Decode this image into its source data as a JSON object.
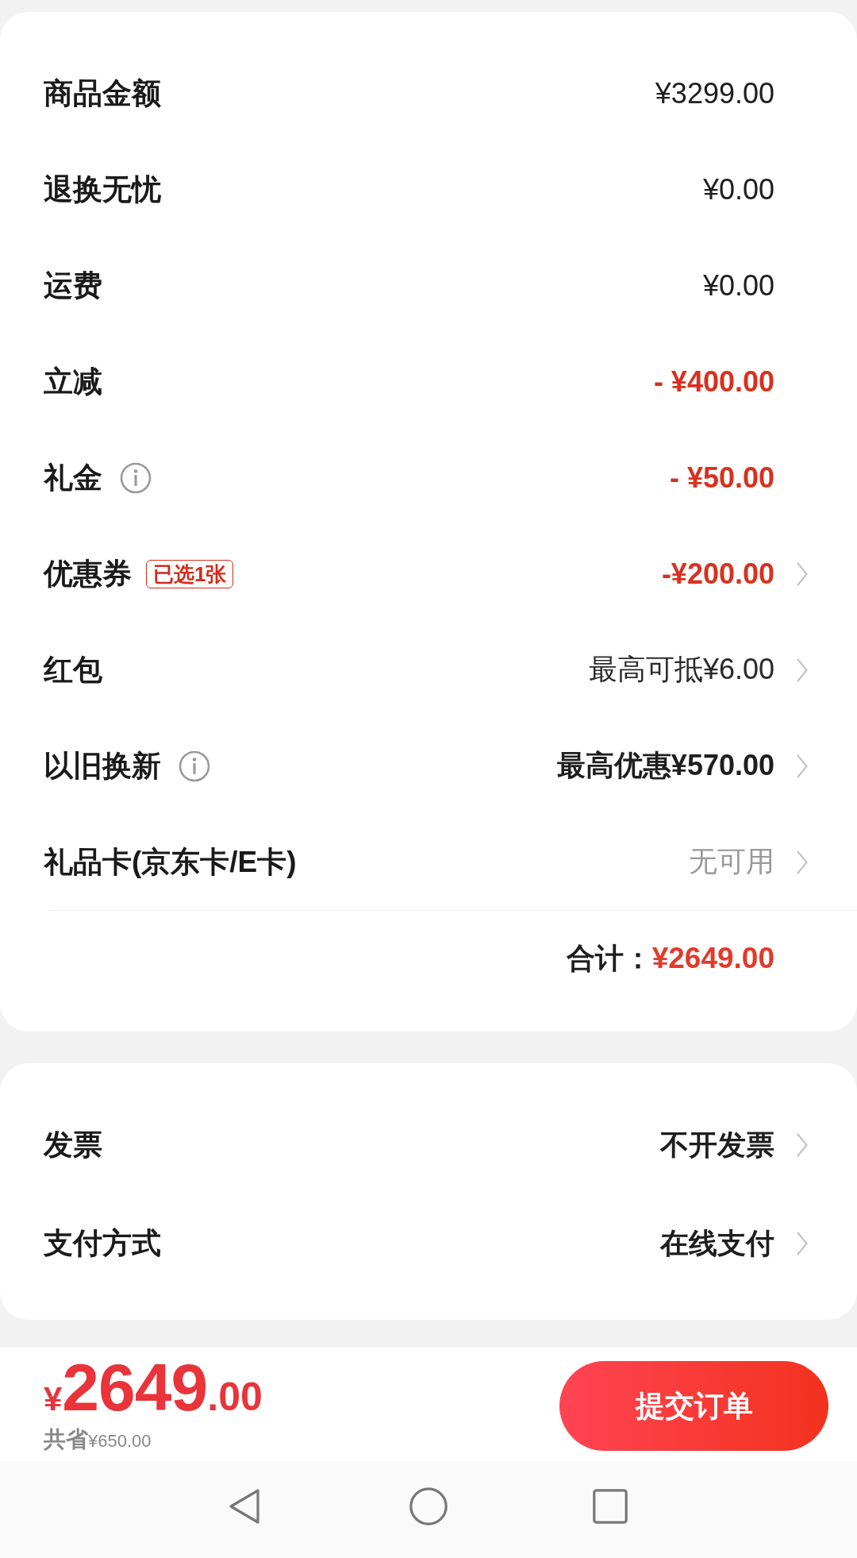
{
  "price_summary": {
    "rows": [
      {
        "label": "商品金额",
        "info": false,
        "value": "¥3299.00",
        "kind": "amount",
        "chevron": false
      },
      {
        "label": "退换无忧",
        "info": false,
        "value": "¥0.00",
        "kind": "amount",
        "chevron": false
      },
      {
        "label": "运费",
        "info": false,
        "value": "¥0.00",
        "kind": "amount",
        "chevron": false
      },
      {
        "label": "立减",
        "info": false,
        "value": "- ¥400.00",
        "kind": "discount",
        "chevron": false
      },
      {
        "label": "礼金",
        "info": true,
        "value": "- ¥50.00",
        "kind": "discount",
        "chevron": false
      },
      {
        "label": "优惠券",
        "info": false,
        "badge": "已选1张",
        "value": "-¥200.00",
        "kind": "discount",
        "chevron": true
      },
      {
        "label": "红包",
        "info": false,
        "value": "最高可抵¥6.00",
        "kind": "hint",
        "chevron": true
      },
      {
        "label": "以旧换新",
        "info": true,
        "value": "最高优惠¥570.00",
        "kind": "offer",
        "chevron": true
      },
      {
        "label": "礼品卡(京东卡/E卡)",
        "info": false,
        "value": "无可用",
        "kind": "unavailable",
        "chevron": true
      }
    ],
    "total": {
      "label": "合计：",
      "value": "¥2649.00"
    }
  },
  "order_options": {
    "rows": [
      {
        "label": "发票",
        "value": "不开发票",
        "kind": "offer",
        "chevron": true
      },
      {
        "label": "支付方式",
        "value": "在线支付",
        "kind": "offer",
        "chevron": true
      }
    ]
  },
  "checkout_bar": {
    "currency": "¥",
    "price_integer": "2649",
    "price_decimal": ".00",
    "savings_label": "共省",
    "savings_value": "¥650.00",
    "submit_button": "提交订单"
  },
  "navigation_bar": {
    "buttons": [
      {
        "kind": "back"
      },
      {
        "kind": "home"
      },
      {
        "kind": "recents"
      }
    ]
  }
}
